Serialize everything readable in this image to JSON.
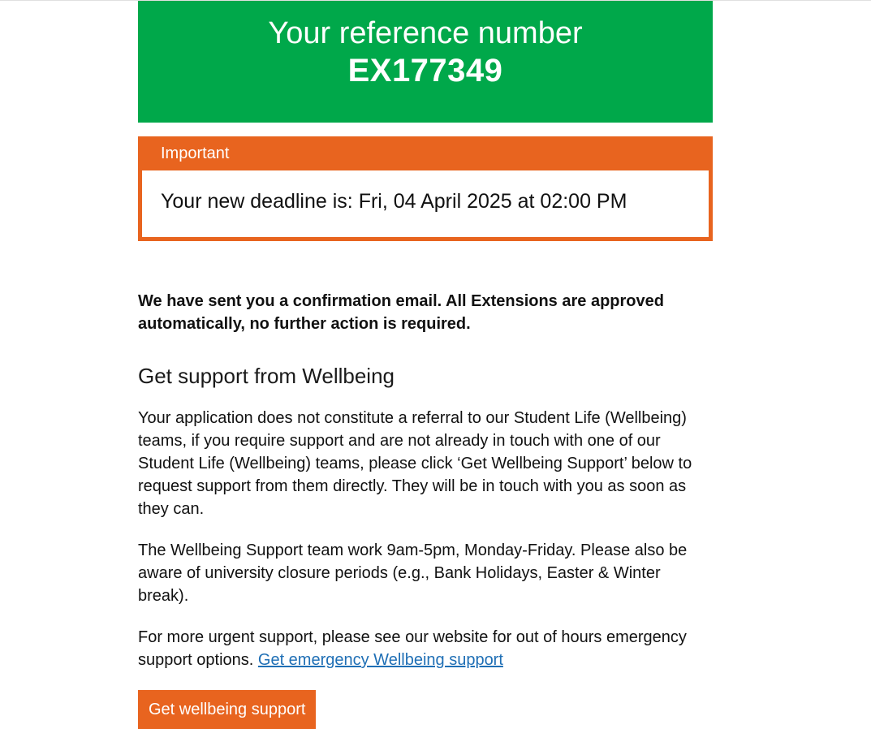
{
  "reference": {
    "title": "Your reference number",
    "number": "EX177349"
  },
  "important": {
    "label": "Important",
    "message": "Your new deadline is: Fri, 04 April 2025 at 02:00 PM"
  },
  "confirmation": "We have sent you a confirmation email. All Extensions are approved automatically, no further action is required.",
  "wellbeing": {
    "heading": "Get support from Wellbeing",
    "paragraph1": "Your application does not constitute a referral to our Student Life (Wellbeing) teams, if you require support and are not already in touch with one of our Student Life (Wellbeing) teams, please click ‘Get Wellbeing Support’ below to request support from them directly. They will be in touch with you as soon as they can.",
    "paragraph2": "The Wellbeing Support team work 9am-5pm, Monday-Friday. Please also be aware of university closure periods (e.g., Bank Holidays, Easter & Winter break).",
    "paragraph3_text": "For more urgent support, please see our website for out of hours emergency support options.",
    "emergency_link": "Get emergency Wellbeing support",
    "button_label": "Get wellbeing support"
  },
  "colors": {
    "reference_panel": "#00a84a",
    "important_accent": "#e8641f",
    "link": "#1f6fb5"
  }
}
